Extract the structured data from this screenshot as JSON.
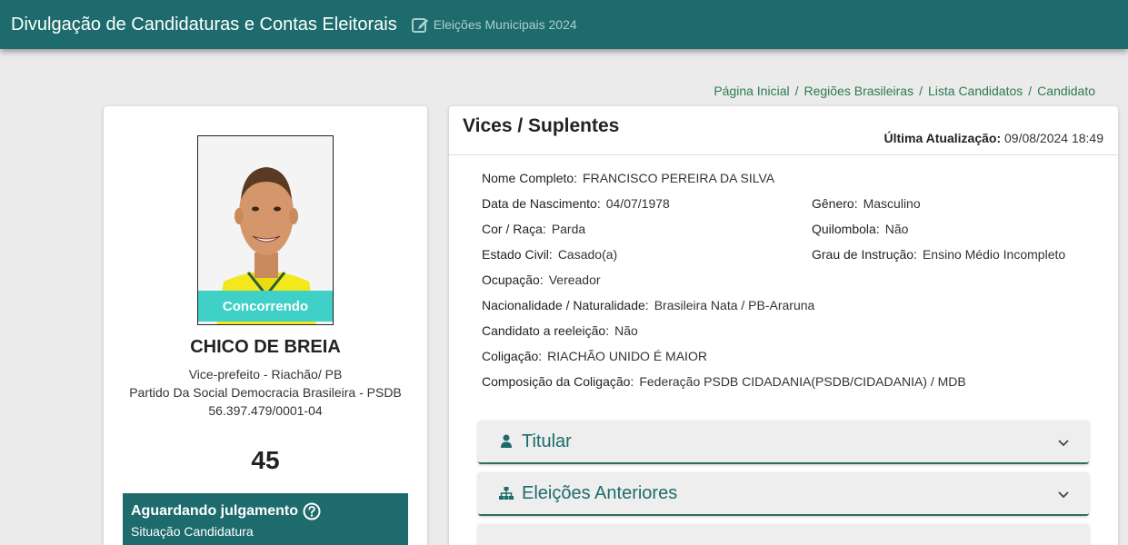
{
  "header": {
    "title": "Divulgação de Candidaturas e Contas Eleitorais",
    "subtitle": "Eleições Municipais 2024"
  },
  "breadcrumb": [
    "Página Inicial",
    "Regiões Brasileiras",
    "Lista Candidatos",
    "Candidato"
  ],
  "candidate": {
    "badge": "Concorrendo",
    "name": "CHICO DE BREIA",
    "role": "Vice-prefeito - Riachão/ PB",
    "party": "Partido Da Social Democracia Brasileira - PSDB",
    "cnpj": "56.397.479/0001-04",
    "number": "45",
    "status_title": "Aguardando julgamento",
    "status_sub": "Situação Candidatura"
  },
  "vices": {
    "title": "Vices / Suplentes",
    "update_label": "Última Atualização:",
    "update_value": "09/08/2024 18:49",
    "fields": {
      "nome": {
        "label": "Nome Completo:",
        "value": "FRANCISCO PEREIRA DA SILVA"
      },
      "nascimento": {
        "label": "Data de Nascimento:",
        "value": "04/07/1978"
      },
      "genero": {
        "label": "Gênero:",
        "value": "Masculino"
      },
      "cor": {
        "label": "Cor / Raça:",
        "value": "Parda"
      },
      "quilombola": {
        "label": "Quilombola:",
        "value": "Não"
      },
      "civil": {
        "label": "Estado Civil:",
        "value": "Casado(a)"
      },
      "instrucao": {
        "label": "Grau de Instrução:",
        "value": "Ensino Médio Incompleto"
      },
      "ocupacao": {
        "label": "Ocupação:",
        "value": "Vereador"
      },
      "nacionalidade": {
        "label": "Nacionalidade / Naturalidade:",
        "value": "Brasileira Nata / PB-Araruna"
      },
      "reeleicao": {
        "label": "Candidato a reeleição:",
        "value": "Não"
      },
      "coligacao": {
        "label": "Coligação:",
        "value": "RIACHÃO UNIDO É MAIOR"
      },
      "composicao": {
        "label": "Composição da Coligação:",
        "value": "Federação PSDB CIDADANIA(PSDB/CIDADANIA) / MDB"
      }
    }
  },
  "accordions": {
    "titular": "Titular",
    "anteriores": "Eleições Anteriores"
  },
  "colors": {
    "header_bg": "#1d6b6c",
    "badge_bg": "#3fd1c7",
    "link": "#2a7b52"
  }
}
